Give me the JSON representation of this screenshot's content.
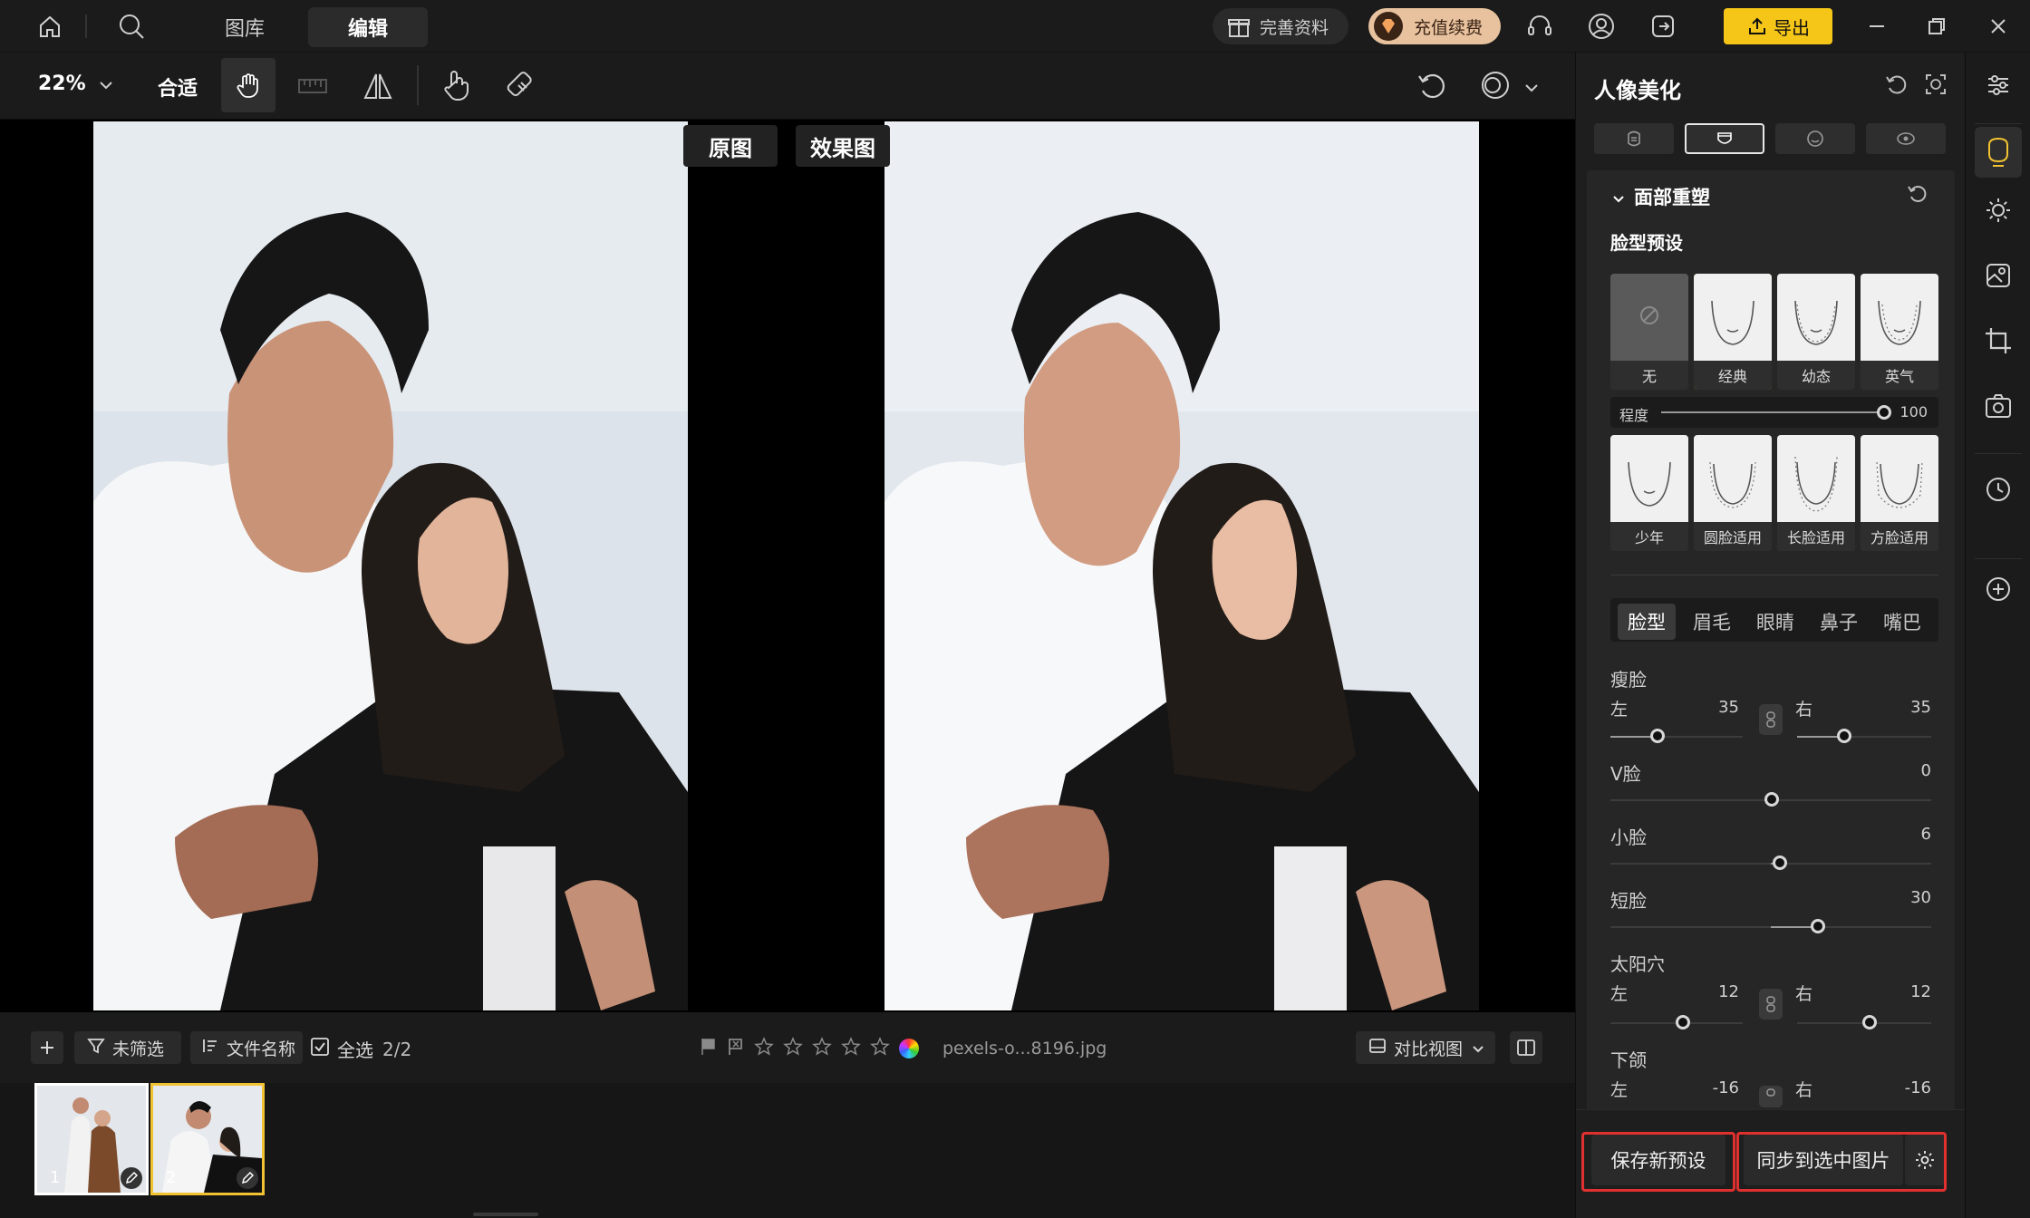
{
  "titlebar": {
    "tabs": [
      "图库",
      "编辑"
    ],
    "active_tab": "编辑",
    "gift_label": "完善资料",
    "vip_label": "充值续费",
    "export_label": "导出",
    "icons": [
      "home-icon",
      "search-icon",
      "gift-icon",
      "headset-icon",
      "user-icon",
      "logout-icon",
      "upload-icon",
      "minimize-icon",
      "restore-icon",
      "close-icon"
    ]
  },
  "toolbar": {
    "zoom": "22%",
    "fit_label": "合适",
    "icons": [
      "hand-icon",
      "ruler-icon",
      "flip-icon",
      "touch-icon",
      "eraser-icon",
      "undo-icon",
      "compare-icon"
    ]
  },
  "canvas": {
    "original_label": "原图",
    "effect_label": "效果图"
  },
  "filmstrip": {
    "add_icon": "plus-icon",
    "filter_label": "未筛选",
    "sort_label": "文件名称",
    "select_all_label": "全选",
    "count": "2/2",
    "filename": "pexels-o...8196.jpg",
    "view_label": "对比视图",
    "thumbs": [
      {
        "index": "1"
      },
      {
        "index": "2"
      }
    ]
  },
  "panel": {
    "title": "人像美化",
    "section_title": "面部重塑",
    "preset_title": "脸型预设",
    "presets_row1": [
      "无",
      "经典",
      "幼态",
      "英气"
    ],
    "selected_preset": "经典",
    "degree_label": "程度",
    "degree_value": "100",
    "presets_row2": [
      "少年",
      "圆脸适用",
      "长脸适用",
      "方脸适用"
    ],
    "subtabs": [
      "脸型",
      "眉毛",
      "眼睛",
      "鼻子",
      "嘴巴"
    ],
    "active_subtab": "脸型",
    "sliders": {
      "slim": {
        "label": "瘦脸",
        "left_label": "左",
        "left_value": "35",
        "right_label": "右",
        "right_value": "35"
      },
      "vface": {
        "label": "V脸",
        "value": "0"
      },
      "small": {
        "label": "小脸",
        "value": "6"
      },
      "short": {
        "label": "短脸",
        "value": "30"
      },
      "temple": {
        "label": "太阳穴",
        "left_label": "左",
        "left_value": "12",
        "right_label": "右",
        "right_value": "12"
      },
      "jaw": {
        "label": "下颌",
        "left_label": "左",
        "left_value": "-16",
        "right_label": "右",
        "right_value": "-16"
      }
    },
    "save_preset_label": "保存新预设",
    "sync_label": "同步到选中图片"
  },
  "colors": {
    "accent": "#f1c232",
    "highlight": "#e0312f"
  }
}
